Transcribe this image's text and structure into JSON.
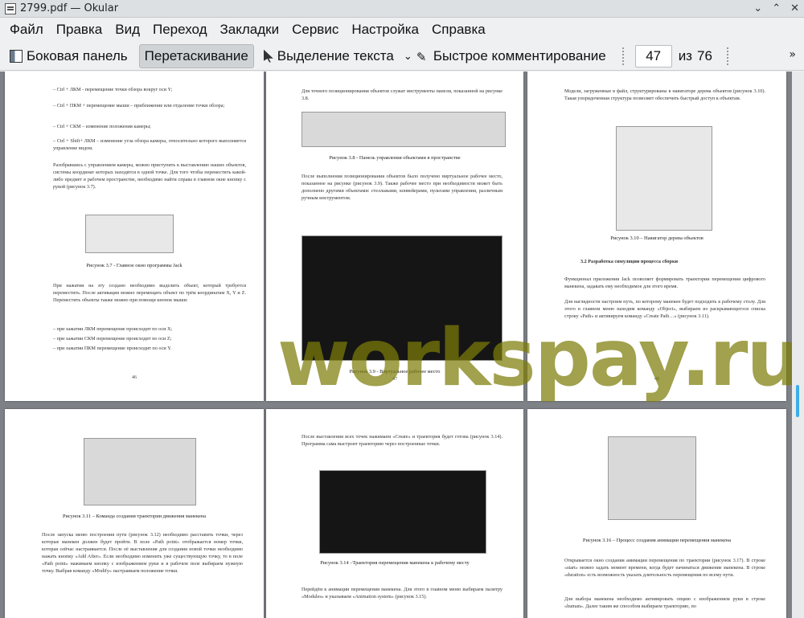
{
  "window": {
    "title": "2799.pdf  — Okular",
    "controls": [
      "⌄",
      "⌃",
      "✕"
    ]
  },
  "menu": [
    "Файл",
    "Правка",
    "Вид",
    "Переход",
    "Закладки",
    "Сервис",
    "Настройка",
    "Справка"
  ],
  "toolbar": {
    "sidebar_label": "Боковая панель",
    "drag_label": "Перетаскивание",
    "select_text_label": "Выделение текста",
    "quick_annotate_label": "Быстрое комментирование",
    "page_current": "47",
    "page_of": "из",
    "page_total": "76",
    "more": "»"
  },
  "watermark": "workspay.ru",
  "pages": {
    "p46": {
      "lines": [
        "–   Ctrl + ЛКМ - перемещение точки обзора вокруг оси Y;",
        "–   Ctrl + ПКМ + перемещение мыши – приближение или отдаление точки обзора;",
        "–   Ctrl + СКМ – изменение положения камеры;",
        "–   Ctrl + Shift+ ЛКМ – изменение угла обзора камеры, относительно которого выполняется управление видом.",
        "Разобравшись с управлением камеры, можно приступить к выставлению наших объектов, системы координат которых находятся в одной точке. Для того чтобы переместить какой-либо предмет в рабочем пространстве, необходимо найти справа в главном окне кнопку с рукой (рисунок 3.7).",
        "При нажатии на эту создано необходимо выделить объект, который требуется переместить. После активации можно перемещать объект по трём координатам X, Y и Z. Переместить объекты также можно при помощи кнопок мыши:",
        "–   при зажатии ЛКМ перемещение происходит по оси X;",
        "–   при зажатии СКМ перемещение происходит по оси Z;",
        "–   при зажатии ПКМ перемещение происходит по оси Y."
      ],
      "caption": "Рисунок 3.7 - Главное окно программы Jack",
      "number": "46"
    },
    "p47": {
      "lines": [
        "Для точного позиционирования объектов служат инструменты панели, показанной на рисунке 3.8.",
        "После выполнения позиционирования объектов было получено виртуальное рабочее место, показанное на рисунке (рисунок 3.9). Также рабочее место при необходимости может быть дополнено другими объектами: стеллажами, конвейерами, пультами управления, различным ручным инструментом."
      ],
      "caption_a": "Рисунок 3.8 - Панель управления объектами в пространстве",
      "caption_b": "Рисунок 3.9 - Виртуальное рабочее место",
      "number": "47"
    },
    "p48": {
      "lines": [
        "Модели, загруженные в файл, структурированы в навигаторе дерева объектов (рисунок 3.10). Такая упорядоченная структура позволяет обеспечить быстрый доступ к объектам.",
        "3.2 Разработка симуляции процесса сборки",
        "Функционал приложения Jack позволяет формировать траектории перемещения цифрового манекена, задавать ему необходимое для этого время.",
        "Для наглядности настроим путь, по которому манекен будет подходить к рабочему столу. Для этого в главном меню находим команду «Object», выбираем из раскрывающегося списка строку «Path» и активируем команду «Create Path…» (рисунок 3.11)."
      ],
      "caption": "Рисунок 3.10 – Навигатор дерева объектов",
      "number": "48"
    },
    "p49": {
      "lines": [
        "После запуска меню построения пути (рисунок 3.12) необходимо расставить точки, через которые манекен должен будет пройти. В поле «Path point» отображается номер точки, которая сейчас настраивается. После её выставления для создания новой точки необходимо нажать кнопку «Add After». Если необходимо изменить уже существующую точку, то в поле «Path point» нажимаем кнопку с изображением руки и в рабочем поле выбираем нужную точку. Выбрав команду «Modify» настраиваем положение точки."
      ],
      "caption": "Рисунок 3.11 – Команда создания траектории движения манекена"
    },
    "p50": {
      "lines": [
        "После выставления всех точек нажимаем «Create» и траектория будет готова (рисунок 3.14). Программа сама выстроит траекторию через построенные точки.",
        "Перейдём к анимации перемещения манекена. Для этого в главном меню выбираем палитру «Modules» и указываем «Animation system» (рисунок 3.15)."
      ],
      "caption": "Рисунок 3.14 –Траектория перемещения манекена к рабочему месту"
    },
    "p51": {
      "lines": [
        "Открывается окно создания анимации перемещения по траектории (рисунок 3.17). В строке «start» можно задать момент времени, когда будет начинаться движение манекена. В строке «duration» есть возможность указать длительность перемещения по всему пути.",
        "Для выбора манекена необходимо активировать опцию с изображением руки в строке «human». Далее таким же способом выбираем траекторию, по"
      ],
      "caption": "Рисунок 3.16 – Процесс создания анимации перемещения манекена"
    }
  }
}
